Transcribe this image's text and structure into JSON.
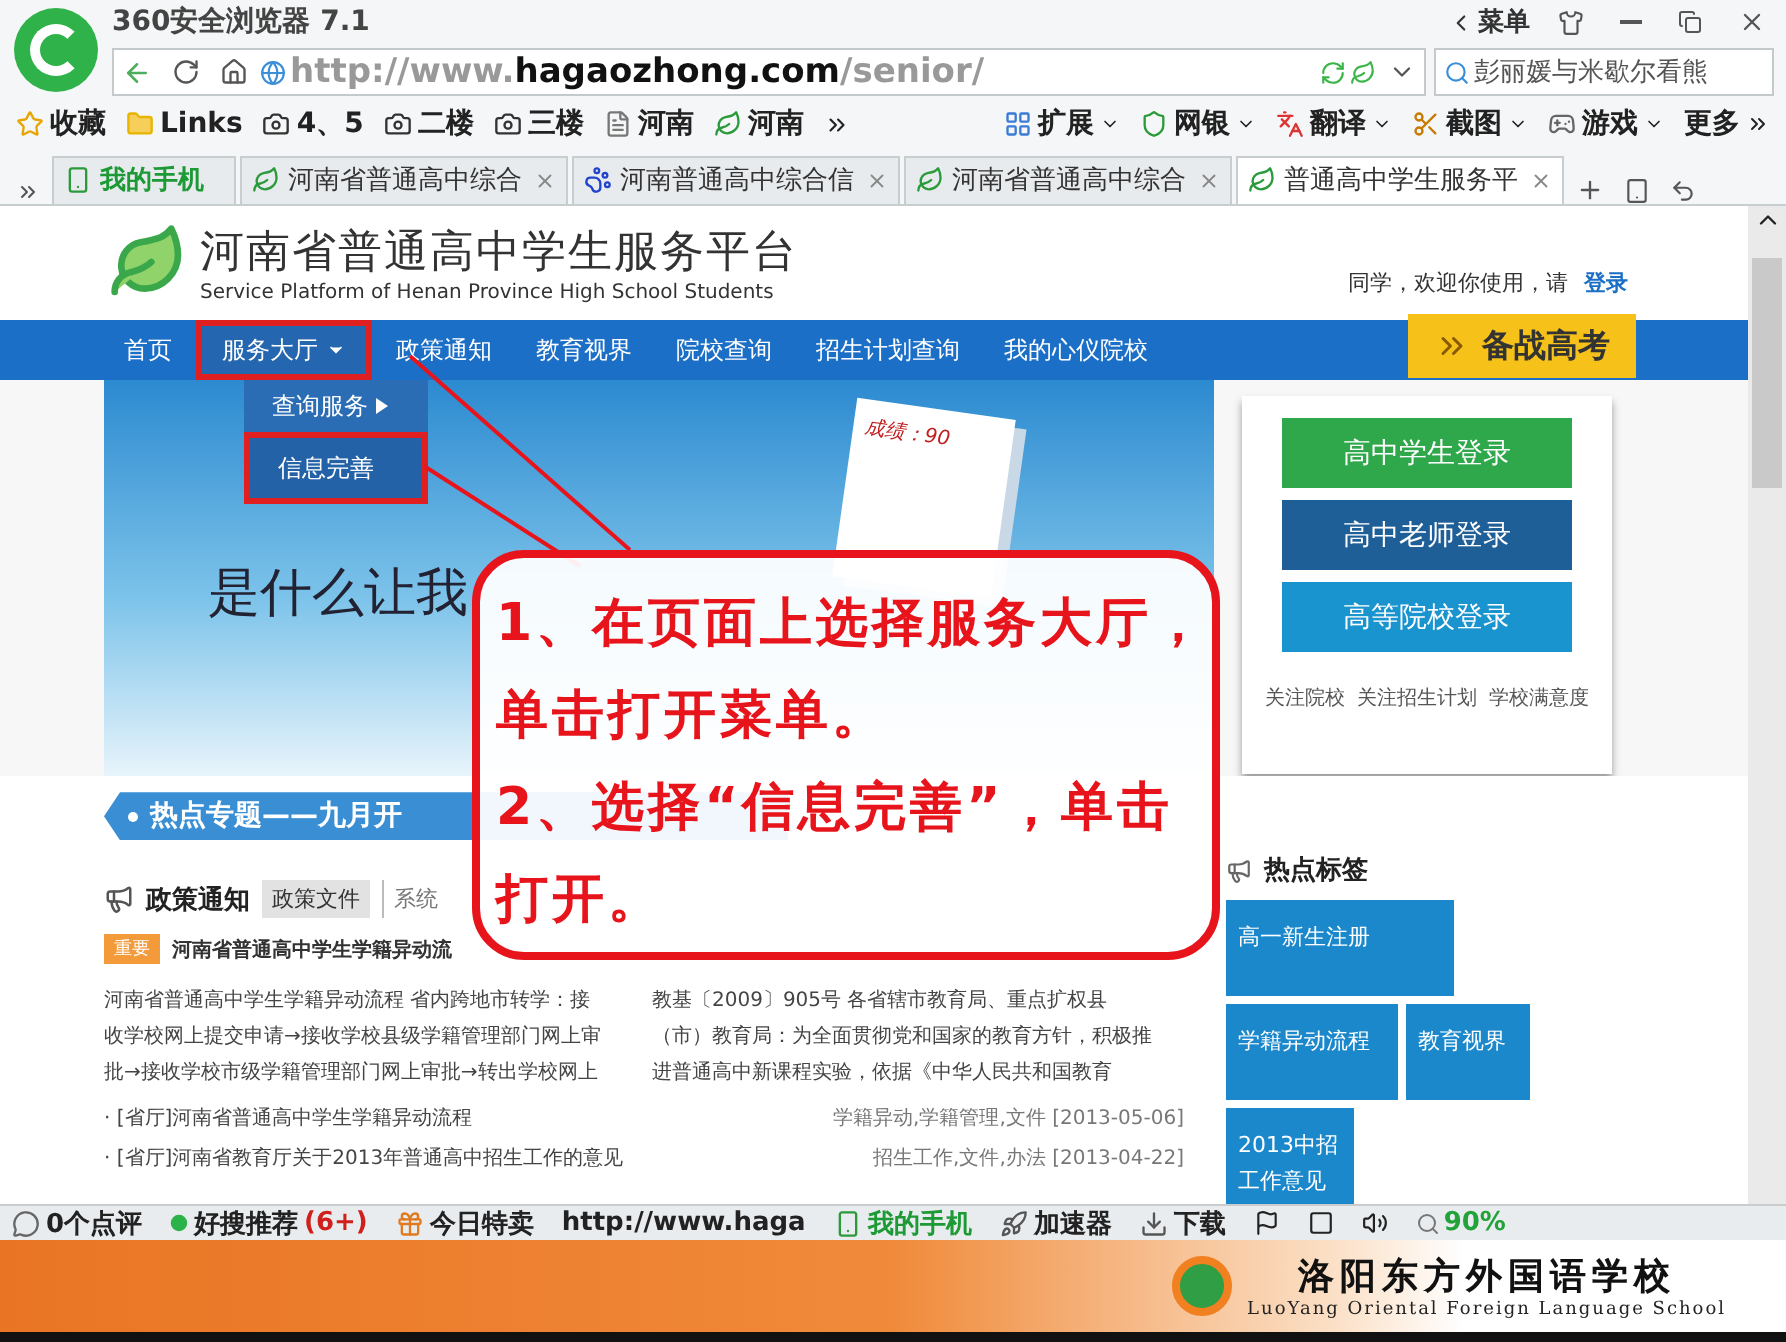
{
  "browser": {
    "title": "360安全浏览器 7.1",
    "menu": "菜单",
    "url_prefix": "http://www.",
    "url_domain": "hagaozhong.com",
    "url_path": "/senior/",
    "search_value": "彭丽媛与米歇尔看熊"
  },
  "bookmarks": [
    {
      "label": "收藏",
      "kind": "star"
    },
    {
      "label": "Links",
      "kind": "folder"
    },
    {
      "label": "4、5",
      "kind": "camera"
    },
    {
      "label": "二楼",
      "kind": "camera"
    },
    {
      "label": "三楼",
      "kind": "camera"
    },
    {
      "label": "河南",
      "kind": "page"
    },
    {
      "label": "河南",
      "kind": "leaf"
    }
  ],
  "tools": [
    {
      "label": "扩展",
      "kind": "grid"
    },
    {
      "label": "网银",
      "kind": "shield"
    },
    {
      "label": "翻译",
      "kind": "translate"
    },
    {
      "label": "截图",
      "kind": "scissors"
    },
    {
      "label": "游戏",
      "kind": "game"
    }
  ],
  "more": "更多",
  "tabs": [
    {
      "label": "我的手机",
      "kind": "phone",
      "selected": false
    },
    {
      "label": "河南省普通高中综合",
      "kind": "leaf",
      "selected": false
    },
    {
      "label": "河南普通高中综合信",
      "kind": "paw",
      "selected": false
    },
    {
      "label": "河南省普通高中综合",
      "kind": "leaf",
      "selected": false
    },
    {
      "label": "普通高中学生服务平",
      "kind": "leaf",
      "selected": true
    }
  ],
  "site": {
    "title": "河南省普通高中学生服务平台",
    "subtitle": "Service Platform of Henan Province High School Students",
    "greeting": "同学，欢迎你使用，请",
    "login": "登录",
    "nav": [
      {
        "label": "首页",
        "kind": "link",
        "selected": false
      },
      {
        "label": "服务大厅",
        "kind": "menu",
        "selected": true
      },
      {
        "label": "政策通知",
        "kind": "link",
        "selected": false
      },
      {
        "label": "教育视界",
        "kind": "link",
        "selected": false
      },
      {
        "label": "院校查询",
        "kind": "link",
        "selected": false
      },
      {
        "label": "招生计划查询",
        "kind": "link",
        "selected": false
      },
      {
        "label": "我的心仪院校",
        "kind": "link",
        "selected": false
      }
    ],
    "badge": "备战高考",
    "dropdown": [
      {
        "label": "查询服务",
        "kind": "submenu",
        "selected": false
      },
      {
        "label": "信息完善",
        "kind": "item",
        "selected": true
      }
    ],
    "hero": {
      "headline": "是什么让我",
      "score": "成绩：90"
    },
    "login_buttons": [
      {
        "label": "高中学生登录",
        "color": "#2ea84a"
      },
      {
        "label": "高中老师登录",
        "color": "#1f5f98"
      },
      {
        "label": "高等院校登录",
        "color": "#1a94cf"
      }
    ],
    "login_links": [
      "关注院校",
      "关注招生计划",
      "学校满意度"
    ],
    "hot_topic": "热点专题——九月开",
    "policy": {
      "title": "政策通知",
      "tabs": [
        {
          "label": "政策文件",
          "selected": true
        },
        {
          "label": "系统",
          "selected": false
        }
      ],
      "featured": {
        "tag": "重要",
        "title": "河南省普通高中学生学籍异动流"
      },
      "paragraphs": [
        "河南省普通高中学生学籍异动流程 省内跨地市转学：接收学校网上提交申请→接收学校县级学籍管理部门网上审批→接收学校市级学籍管理部门网上审批→转出学校网上",
        "教基〔2009〕905号 各省辖市教育局、重点扩权县（市）教育局：为全面贯彻党和国家的教育方针，积极推进普通高中新课程实验，依据《中华人民共和国教育"
      ],
      "items": [
        {
          "title": "· [省厅]河南省普通高中学生学籍异动流程",
          "meta": "学籍异动,学籍管理,文件 [2013-05-06]"
        },
        {
          "title": "· [省厅]河南省教育厅关于2013年普通高中招生工作的意见",
          "meta": "招生工作,文件,办法 [2013-04-22]"
        }
      ]
    },
    "hot_tags": {
      "title": "热点标签",
      "tags": [
        "高一新生注册",
        "学籍异动流程",
        "教育视界",
        "2013中招工作意见"
      ]
    }
  },
  "callout": [
    "1、在页面上选择服务大厅，",
    "单击打开菜单。",
    "2、选择“信息完善”，单击",
    "打开。"
  ],
  "status_bar": [
    {
      "label": "0个点评",
      "kind": "comment"
    },
    {
      "label": "好搜推荐",
      "kind": "dot",
      "count": "(6+)"
    },
    {
      "label": "今日特卖",
      "kind": "gift"
    },
    {
      "label": "http://www.haga",
      "kind": "plain"
    },
    {
      "label": "我的手机",
      "kind": "phone"
    },
    {
      "label": "加速器",
      "kind": "rocket"
    },
    {
      "label": "下载",
      "kind": "download"
    }
  ],
  "zoom": "90%",
  "footer": {
    "name": "洛阳东方外国语学校",
    "subtitle": "LuoYang Oriental Foreign Language School"
  }
}
